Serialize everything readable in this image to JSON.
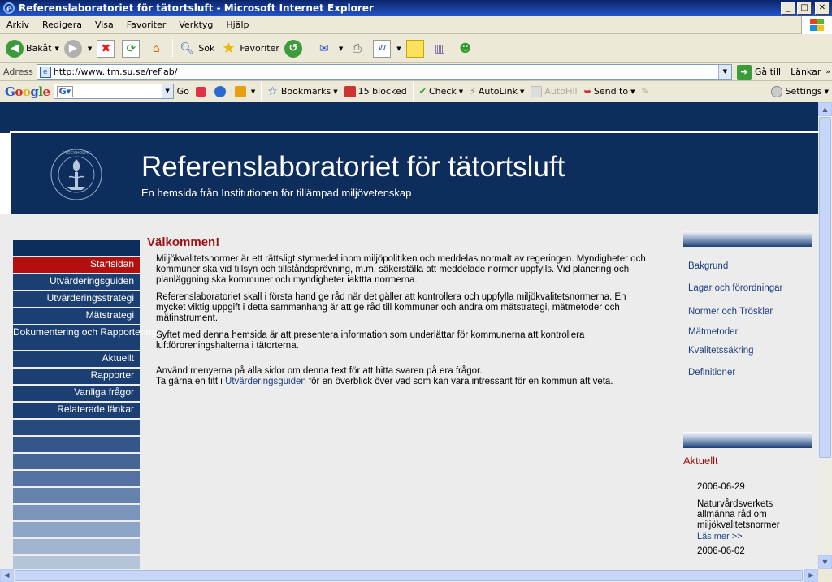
{
  "window": {
    "title": "Referenslaboratoriet för tätortsluft - Microsoft Internet Explorer"
  },
  "menu": [
    "Arkiv",
    "Redigera",
    "Visa",
    "Favoriter",
    "Verktyg",
    "Hjälp"
  ],
  "toolbar": {
    "back": "Bakåt",
    "search": "Sök",
    "favorites": "Favoriter"
  },
  "address": {
    "label": "Adress",
    "url": "http://www.itm.su.se/reflab/",
    "go": "Gå till",
    "links": "Länkar"
  },
  "googlebar": {
    "go": "Go",
    "bookmarks": "Bookmarks",
    "blocked": "15 blocked",
    "check": "Check",
    "autolink": "AutoLink",
    "autofill": "AutoFill",
    "sendto": "Send to",
    "settings": "Settings"
  },
  "site": {
    "title": "Referenslaboratoriet för tätortsluft",
    "subtitle": "En hemsida från Institutionen för tillämpad miljövetenskap"
  },
  "nav": [
    {
      "label": "Startsidan",
      "active": true
    },
    {
      "label": "Utvärderingsguiden"
    },
    {
      "label": "Utvärderingsstrategi"
    },
    {
      "label": "Mätstrategi"
    },
    {
      "label": "Dokumentering och Rapportering"
    },
    {
      "label": "Aktuellt"
    },
    {
      "label": "Rapporter"
    },
    {
      "label": "Vanliga frågor"
    },
    {
      "label": "Relaterade länkar"
    }
  ],
  "nav_blank_colors": [
    "#28497b",
    "#35568a",
    "#446595",
    "#5573a2",
    "#6683ad",
    "#7a94bb",
    "#8ea6c6",
    "#a2b5d0",
    "#b4c4d9"
  ],
  "main": {
    "heading": "Välkommen!",
    "p1": "Miljökvalitetsnormer är ett rättsligt styrmedel inom miljöpolitiken och meddelas normalt av regeringen. Myndigheter och kommuner ska vid tillsyn och tillståndsprövning, m.m. säkerställa att meddelade normer uppfylls. Vid planering och planläggning ska kommuner och myndigheter iakttta normerna.",
    "p2": "Referenslaboratoriet skall i första hand ge råd när det gäller att kontrollera och uppfylla miljökvalitetsnormerna. En mycket viktig uppgift i detta sammanhang är att ge råd till kommuner och andra om mätstrategi, mätmetoder och mätinstrument.",
    "p3": "Syftet med denna hemsida är att presentera information som underlättar för kommunerna att kontrollera luftföroreningshalterna i tätorterna.",
    "p4": "Använd menyerna på alla sidor om denna text för att hitta svaren på era frågor.",
    "p5_before": "Ta gärna en titt i ",
    "p5_link": "Utvärderingsguiden",
    "p5_after": " för en överblick över vad som kan vara intressant för en kommun att veta."
  },
  "right": {
    "links": [
      "Bakgrund",
      "Lagar och förordningar",
      "Normer och Trösklar",
      "Mätmetoder",
      "Kvalitetssäkring",
      "Definitioner"
    ],
    "news_heading": "Aktuellt",
    "news_date1": "2006-06-29",
    "news_text1": "Naturvårdsverkets allmänna råd om miljökvalitetsnormer",
    "news_more1": "Läs mer >>",
    "news_date2": "2006-06-02"
  },
  "colors": {
    "navy": "#0d2d5c",
    "nav_item": "#1c3f73",
    "active": "#b30f0f",
    "heading_red": "#9b1111",
    "link": "#1c3f80"
  }
}
